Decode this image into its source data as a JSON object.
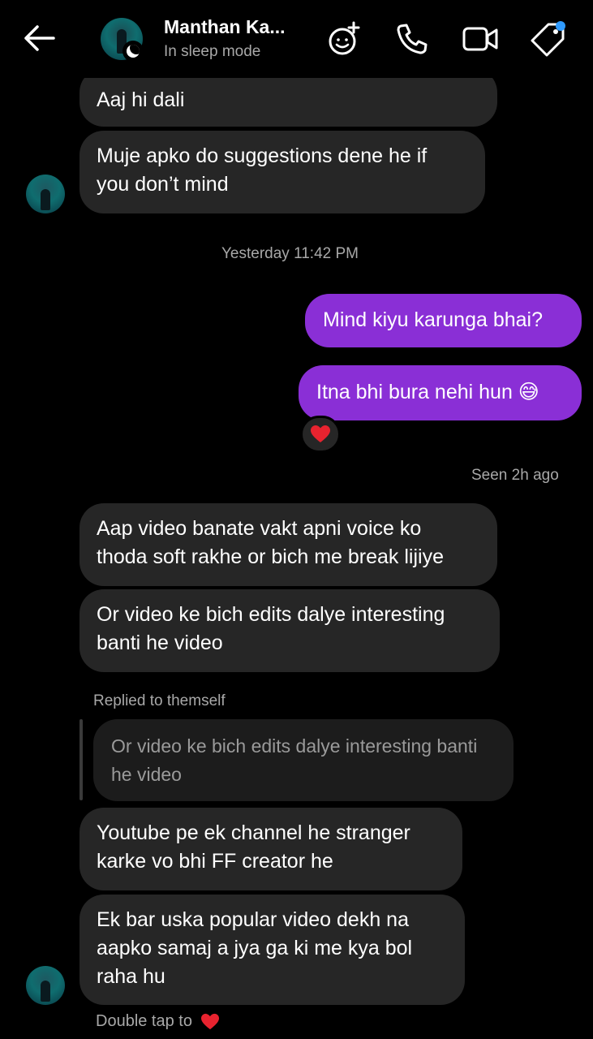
{
  "header": {
    "contact_name": "Manthan Ka...",
    "status": "In sleep mode",
    "icons": [
      "back-arrow-icon",
      "effects-icon",
      "phone-icon",
      "video-camera-icon",
      "tag-icon"
    ],
    "badge_color": "#2f9bff"
  },
  "messages": {
    "m1": "Aaj hi dali",
    "m2_line1": "Muje apko do suggestions dene he if",
    "m2_line2": "you don’t mind",
    "timestamp": "Yesterday 11:42 PM",
    "m3": "Mind kiyu karunga bhai?",
    "m4": "Itna bhi bura nehi hun 😅",
    "reaction": "❤️",
    "seen": "Seen 2h ago",
    "m5_line1": "Aap video banate vakt apni voice ko",
    "m5_line2": "thoda soft rakhe or bich me break lijiye",
    "m6_line1": "Or video ke bich edits dalye interesting",
    "m6_line2": "banti he video",
    "replied_label": "Replied to themself",
    "quote_line1": "Or video ke bich edits dalye interesting banti",
    "quote_line2": "he video",
    "m7_line1": "Youtube pe ek channel he stranger",
    "m7_line2": "karke vo bhi FF creator he",
    "m8_line1": "Ek bar uska popular video dekh na",
    "m8_line2": "aapko samaj a jya ga ki me kya bol",
    "m8_line3": "raha hu"
  },
  "footer": {
    "hint": "Double tap to"
  },
  "colors": {
    "outgoing": "#8a2fd6",
    "incoming": "#262626",
    "background": "#000000",
    "heart": "#e8232f"
  }
}
